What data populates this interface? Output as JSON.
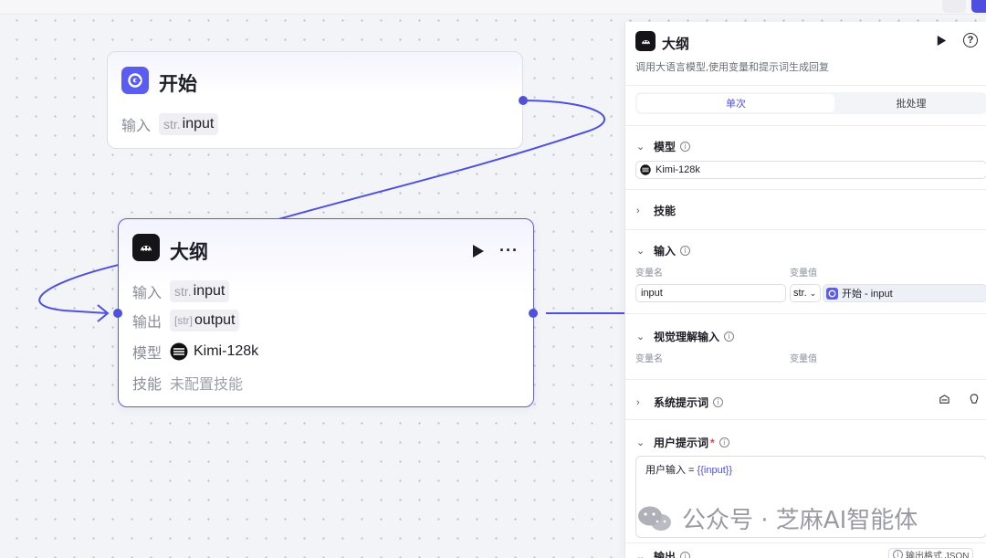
{
  "canvas": {
    "start_node": {
      "title": "开始",
      "input_label": "输入",
      "input_type": "str.",
      "input_name": "input"
    },
    "outline_node": {
      "title": "大纲",
      "input_label": "输入",
      "input_type": "str.",
      "input_name": "input",
      "output_label": "输出",
      "output_type": "[str]",
      "output_name": "output",
      "model_label": "模型",
      "model_value": "Kimi-128k",
      "skill_label": "技能",
      "skill_value": "未配置技能",
      "more_label": "···"
    },
    "accent_color": "#4f50dc"
  },
  "panel": {
    "title": "大纲",
    "description": "调用大语言模型,使用变量和提示词生成回复",
    "tabs": [
      {
        "label": "单次",
        "active": true
      },
      {
        "label": "批处理",
        "active": false
      }
    ],
    "model_section": {
      "label": "模型",
      "value": "Kimi-128k"
    },
    "skills_section": {
      "label": "技能"
    },
    "input_section": {
      "label": "输入",
      "col_name": "变量名",
      "col_value": "变量值",
      "var_name": "input",
      "var_type": "str.",
      "ref_value": "开始 - input"
    },
    "vision_section": {
      "label": "视觉理解输入",
      "col_name": "变量名",
      "col_value": "变量值"
    },
    "system_prompt_section": {
      "label": "系统提示词"
    },
    "user_prompt_section": {
      "label": "用户提示词",
      "required_mark": "*",
      "prompt_text": "用户输入 = ",
      "prompt_var": "{{input}}"
    },
    "output_section": {
      "label": "输出",
      "format_label": "输出格式 JSON"
    }
  },
  "watermark": {
    "text": "公众号 · 芝麻AI智能体"
  }
}
